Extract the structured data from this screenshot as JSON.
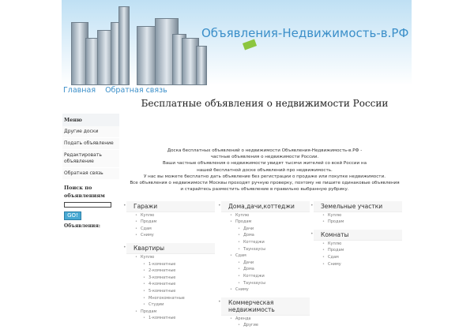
{
  "site_title": "Объявления-Недвижимость-в.РФ",
  "nav": [
    "Главная",
    "Обратная связь"
  ],
  "page_title": "Бесплатные объявления о недвижимости России",
  "sidebar": {
    "menu_title": "Меню",
    "items": [
      "Другие доски",
      "Подать объявление",
      "Редактировать объявление",
      "Обратная связь"
    ],
    "search_label": "Поиск по объявлениям",
    "search_value": "",
    "search_button": "GO!",
    "ads_label": "Объявления:"
  },
  "intro": [
    "Доска бесплатных объявлений о недвижимости Объявления-Недвижимость-в.РФ -",
    "частные объявления о недвижимости России.",
    "Ваши частные объявления о недвижимости увидят тысячи жителей со всей России на",
    "нашей бесплатной доске объявлений про недвижимость.",
    "У нас вы можете бесплатно дать объявление без регистрации о продаже или покупке недвижимости.",
    "Все объявления о недвижимости Москвы проходят ручную проверку, поэтому не пишите одинаковые объявления",
    "и старайтесь разместить объявление в правильно выбранную рубрику."
  ],
  "columns": [
    [
      {
        "title": "Гаражи",
        "items": [
          {
            "l": "Куплю"
          },
          {
            "l": "Продам"
          },
          {
            "l": "Сдам"
          },
          {
            "l": "Сниму"
          }
        ]
      },
      {
        "title": "Квартиры",
        "items": [
          {
            "l": "Куплю",
            "sub": [
              "1-комнатные",
              "2-комнатные",
              "3-комнатные",
              "4-комнатные",
              "5-комнатные",
              "Многокомнатные",
              "Студии"
            ]
          },
          {
            "l": "Продам",
            "sub": [
              "1-комнатные"
            ]
          }
        ]
      }
    ],
    [
      {
        "title": "Дома,дачи,коттеджи",
        "items": [
          {
            "l": "Куплю"
          },
          {
            "l": "Продам",
            "sub": [
              "Дачи",
              "Дома",
              "Коттеджи",
              "Таунхаусы"
            ]
          },
          {
            "l": "Сдам",
            "sub": [
              "Дачи",
              "Дома",
              "Коттеджи",
              "Таунхаусы"
            ]
          },
          {
            "l": "Сниму"
          }
        ]
      },
      {
        "title": "Коммерческая недвижимость",
        "items": [
          {
            "l": "Аренда",
            "sub": [
              "Другие"
            ]
          }
        ]
      }
    ],
    [
      {
        "title": "Земельные участки",
        "items": [
          {
            "l": "Куплю"
          },
          {
            "l": "Продам"
          }
        ]
      },
      {
        "title": "Комнаты",
        "items": [
          {
            "l": "Куплю"
          },
          {
            "l": "Продам"
          },
          {
            "l": "Сдам"
          },
          {
            "l": "Сниму"
          }
        ]
      }
    ]
  ]
}
